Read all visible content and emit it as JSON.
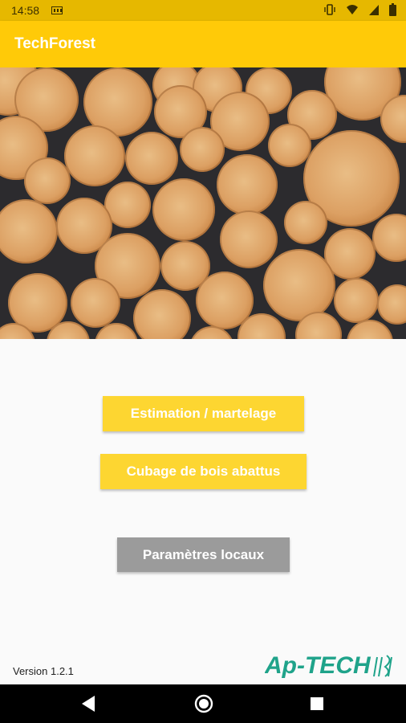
{
  "status_bar": {
    "time": "14:58"
  },
  "app_bar": {
    "title": "TechForest"
  },
  "buttons": {
    "estimation": "Estimation / martelage",
    "cubage": "Cubage de bois abattus",
    "parametres": "Paramètres locaux"
  },
  "footer": {
    "version": "Version 1.2.1",
    "logo_text": "Ap-TECH"
  },
  "colors": {
    "status_bar": "#e6b800",
    "app_bar": "#ffca08",
    "primary_button": "#fdd631",
    "secondary_button": "#9b9b9b",
    "logo": "#1fa38a"
  },
  "icons": [
    "sim-card-icon",
    "vibrate-icon",
    "wifi-icon",
    "signal-icon",
    "battery-icon",
    "back-icon",
    "home-icon",
    "recents-icon"
  ]
}
